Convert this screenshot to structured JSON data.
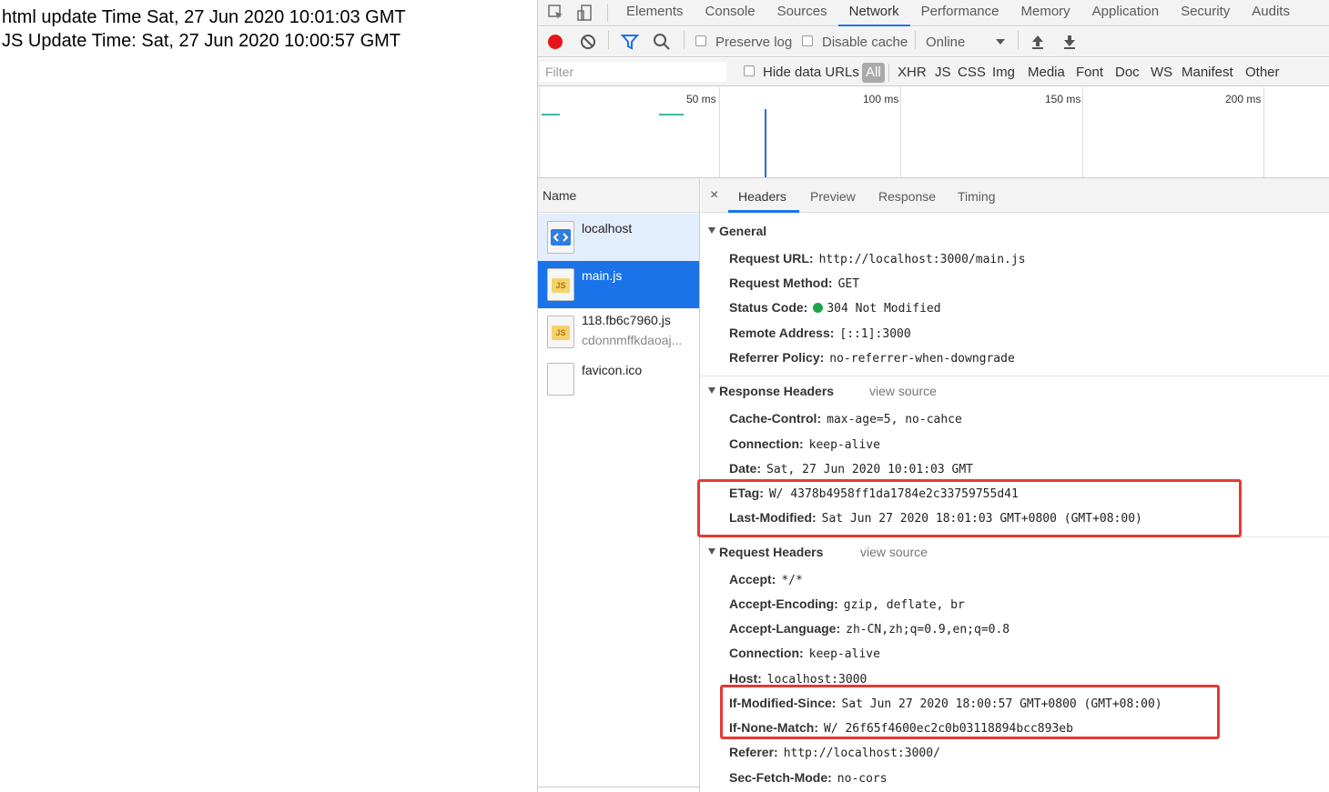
{
  "page": {
    "line1": "html update Time Sat, 27 Jun 2020 10:01:03 GMT",
    "line2": "JS Update Time: Sat, 27 Jun 2020 10:00:57 GMT"
  },
  "devtools": {
    "tabs": [
      "Elements",
      "Console",
      "Sources",
      "Network",
      "Performance",
      "Memory",
      "Application",
      "Security",
      "Audits"
    ],
    "active_tab": "Network",
    "toolbar": {
      "preserve_log": "Preserve log",
      "disable_cache": "Disable cache",
      "throttling": "Online"
    },
    "filter": {
      "placeholder": "Filter",
      "hide_data_urls": "Hide data URLs",
      "all": "All",
      "types": [
        "XHR",
        "JS",
        "CSS",
        "Img",
        "Media",
        "Font",
        "Doc",
        "WS",
        "Manifest",
        "Other"
      ]
    },
    "overview": {
      "ticks": [
        "50 ms",
        "100 ms",
        "150 ms",
        "200 ms"
      ]
    },
    "requests": {
      "header": "Name",
      "items": [
        {
          "name": "localhost",
          "sub": ""
        },
        {
          "name": "main.js",
          "sub": ""
        },
        {
          "name": "118.fb6c7960.js",
          "sub": "cdonnmffkdaoaj..."
        },
        {
          "name": "favicon.ico",
          "sub": ""
        }
      ]
    },
    "details": {
      "close": "×",
      "tabs": [
        "Headers",
        "Preview",
        "Response",
        "Timing"
      ],
      "general": {
        "title": "General",
        "rows": [
          {
            "key": "Request URL:",
            "value": "http://localhost:3000/main.js"
          },
          {
            "key": "Request Method:",
            "value": "GET"
          },
          {
            "key": "Status Code:",
            "value": "304 Not Modified"
          },
          {
            "key": "Remote Address:",
            "value": "[::1]:3000"
          },
          {
            "key": "Referrer Policy:",
            "value": "no-referrer-when-downgrade"
          }
        ]
      },
      "response_headers": {
        "title": "Response Headers",
        "view_source": "view source",
        "rows": [
          {
            "key": "Cache-Control:",
            "value": "max-age=5, no-cahce"
          },
          {
            "key": "Connection:",
            "value": "keep-alive"
          },
          {
            "key": "Date:",
            "value": "Sat, 27 Jun 2020 10:01:03 GMT"
          },
          {
            "key": "ETag:",
            "value": "W/ 4378b4958ff1da1784e2c33759755d41"
          },
          {
            "key": "Last-Modified:",
            "value": "Sat Jun 27 2020 18:01:03 GMT+0800 (GMT+08:00)"
          }
        ]
      },
      "request_headers": {
        "title": "Request Headers",
        "view_source": "view source",
        "rows": [
          {
            "key": "Accept:",
            "value": "*/*"
          },
          {
            "key": "Accept-Encoding:",
            "value": "gzip, deflate, br"
          },
          {
            "key": "Accept-Language:",
            "value": "zh-CN,zh;q=0.9,en;q=0.8"
          },
          {
            "key": "Connection:",
            "value": "keep-alive"
          },
          {
            "key": "Host:",
            "value": "localhost:3000"
          },
          {
            "key": "If-Modified-Since:",
            "value": "Sat Jun 27 2020 18:00:57 GMT+0800 (GMT+08:00)"
          },
          {
            "key": "If-None-Match:",
            "value": "W/ 26f65f4600ec2c0b03118894bcc893eb"
          },
          {
            "key": "Referer:",
            "value": "http://localhost:3000/"
          },
          {
            "key": "Sec-Fetch-Mode:",
            "value": "no-cors"
          }
        ]
      }
    },
    "colors": {
      "accent": "#1a73e8",
      "annotation": "#e53935",
      "status_ok": "#1ea446",
      "record": "#e8141c"
    }
  }
}
